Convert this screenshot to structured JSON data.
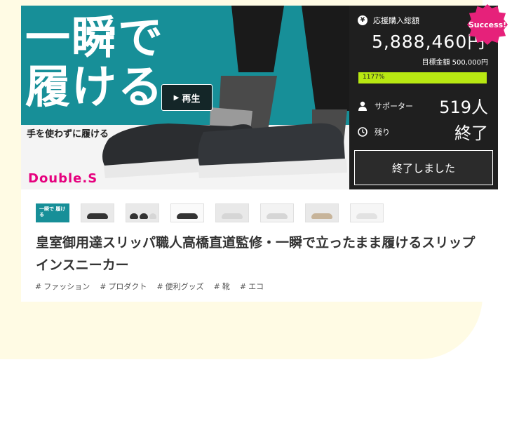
{
  "hero": {
    "headline_line1": "一瞬で",
    "headline_line2": "履ける",
    "subline": "手を使わずに履ける",
    "brand": "Double.S",
    "play_label": "再生"
  },
  "stats": {
    "badge": "Success!",
    "total_label": "応援購入総額",
    "total_amount": "5,888,460円",
    "goal_label": "目標金額",
    "goal_amount": "500,000円",
    "progress_text": "1177%",
    "progress_fraction": 1.0,
    "supporters_label": "サポーター",
    "supporters_value": "519人",
    "remaining_label": "残り",
    "remaining_value": "終了",
    "ended_button": "終了しました"
  },
  "thumbnails": [
    {
      "kind": "headline",
      "caption": "一瞬で 履ける"
    },
    {
      "kind": "legs"
    },
    {
      "kind": "shoes-row"
    },
    {
      "kind": "shoe-dark"
    },
    {
      "kind": "shoe-light"
    },
    {
      "kind": "legs-light"
    },
    {
      "kind": "hand"
    },
    {
      "kind": "sole"
    }
  ],
  "project": {
    "title": "皇室御用達スリッパ職人高橋直道監修・一瞬で立ったまま履けるスリップインスニーカー",
    "tags": [
      "ファッション",
      "プロダクト",
      "便利グッズ",
      "靴",
      "エコ"
    ]
  },
  "colors": {
    "accent_teal": "#178f98",
    "progress_green": "#b8e812",
    "badge_pink": "#e6217a",
    "brand_pink": "#e6007e",
    "panel_dark": "#1f1f1f"
  }
}
